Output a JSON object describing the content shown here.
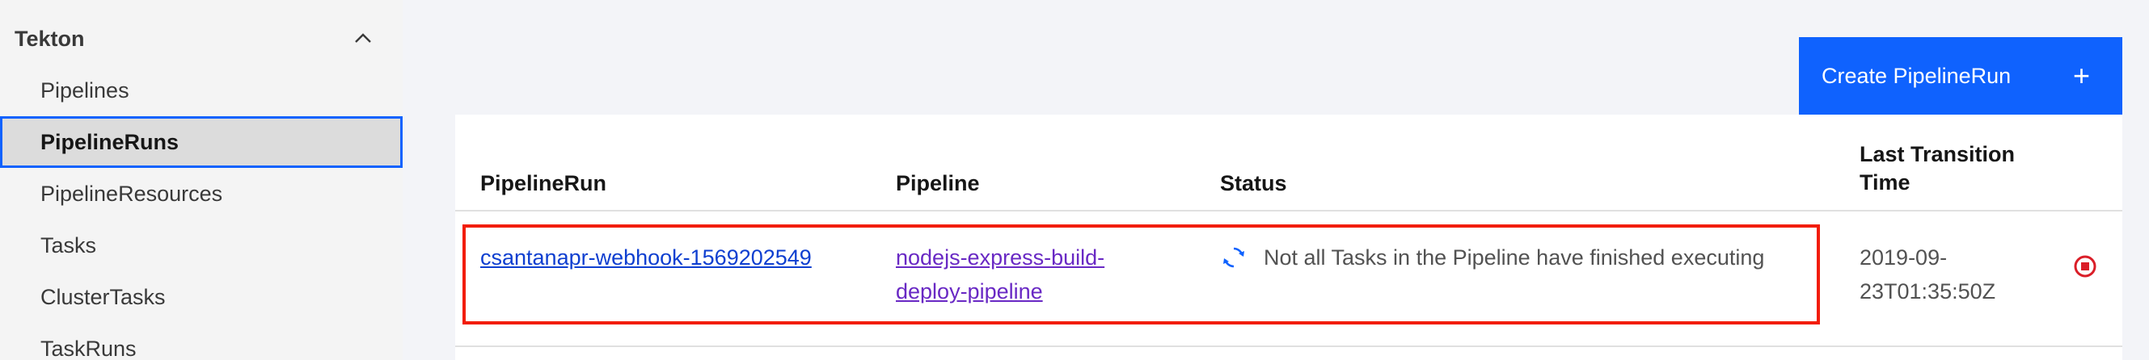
{
  "sidebar": {
    "section_title": "Tekton",
    "items": [
      {
        "label": "Pipelines",
        "active": false
      },
      {
        "label": "PipelineRuns",
        "active": true
      },
      {
        "label": "PipelineResources",
        "active": false
      },
      {
        "label": "Tasks",
        "active": false
      },
      {
        "label": "ClusterTasks",
        "active": false
      },
      {
        "label": "TaskRuns",
        "active": false
      }
    ]
  },
  "toolbar": {
    "create_label": "Create PipelineRun",
    "create_icon": "plus-icon"
  },
  "table": {
    "headers": {
      "pipelinerun": "PipelineRun",
      "pipeline": "Pipeline",
      "status": "Status",
      "last_transition_time": "Last Transition Time"
    },
    "rows": [
      {
        "pipelinerun": "csantanapr-webhook-1569202549",
        "pipeline": "nodejs-express-build-deploy-pipeline",
        "status_icon": "sync-icon",
        "status": "Not all Tasks in the Pipeline have finished executing",
        "last_transition_time": "2019-09-23T01:35:50Z",
        "action_icon": "stop-icon"
      }
    ]
  },
  "colors": {
    "primary": "#0f62fe",
    "link": "#0f3fd0",
    "visited_link": "#6929c4",
    "highlight": "#f21d0a",
    "stop": "#da1e28"
  }
}
